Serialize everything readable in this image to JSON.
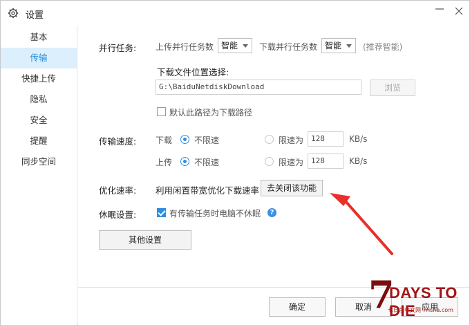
{
  "window": {
    "title": "设置"
  },
  "sidebar": {
    "items": [
      {
        "label": "基本"
      },
      {
        "label": "传输"
      },
      {
        "label": "快捷上传"
      },
      {
        "label": "隐私"
      },
      {
        "label": "安全"
      },
      {
        "label": "提醒"
      },
      {
        "label": "同步空间"
      }
    ],
    "active_index": 1
  },
  "parallel": {
    "label": "并行任务:",
    "upload_label": "上传并行任务数",
    "upload_value": "智能",
    "download_label": "下载并行任务数",
    "download_value": "智能",
    "hint": "(推荐智能)"
  },
  "download_location": {
    "label": "下载文件位置选择:",
    "path": "G:\\BaiduNetdiskDownload",
    "browse_label": "浏览",
    "default_checkbox_label": "默认此路径为下载路径",
    "default_checked": false
  },
  "speed": {
    "label": "传输速度:",
    "download_label": "下载",
    "upload_label": "上传",
    "unlimited_label": "不限速",
    "limit_label": "限速为",
    "download_limit_value": "128",
    "upload_limit_value": "128",
    "unit": "KB/s",
    "download_mode": "unlimited",
    "upload_mode": "unlimited"
  },
  "optimize": {
    "label": "优化速率:",
    "description": "利用闲置带宽优化下载速率",
    "button_label": "去关闭该功能"
  },
  "sleep": {
    "label": "休眠设置:",
    "checkbox_label": "有传输任务时电脑不休眠",
    "checked": true
  },
  "other_button_label": "其他设置",
  "footer": {
    "ok_label": "确定",
    "cancel_label": "取消",
    "apply_label": "应用"
  },
  "watermark": {
    "numeral": "7",
    "text": "DAYS TO DIE",
    "subtext": "七日杀中文网 7risha.com"
  },
  "colors": {
    "accent": "#1e8ee6",
    "sidebar_active_bg": "#dceffc",
    "annotation_arrow": "#e8302a"
  }
}
